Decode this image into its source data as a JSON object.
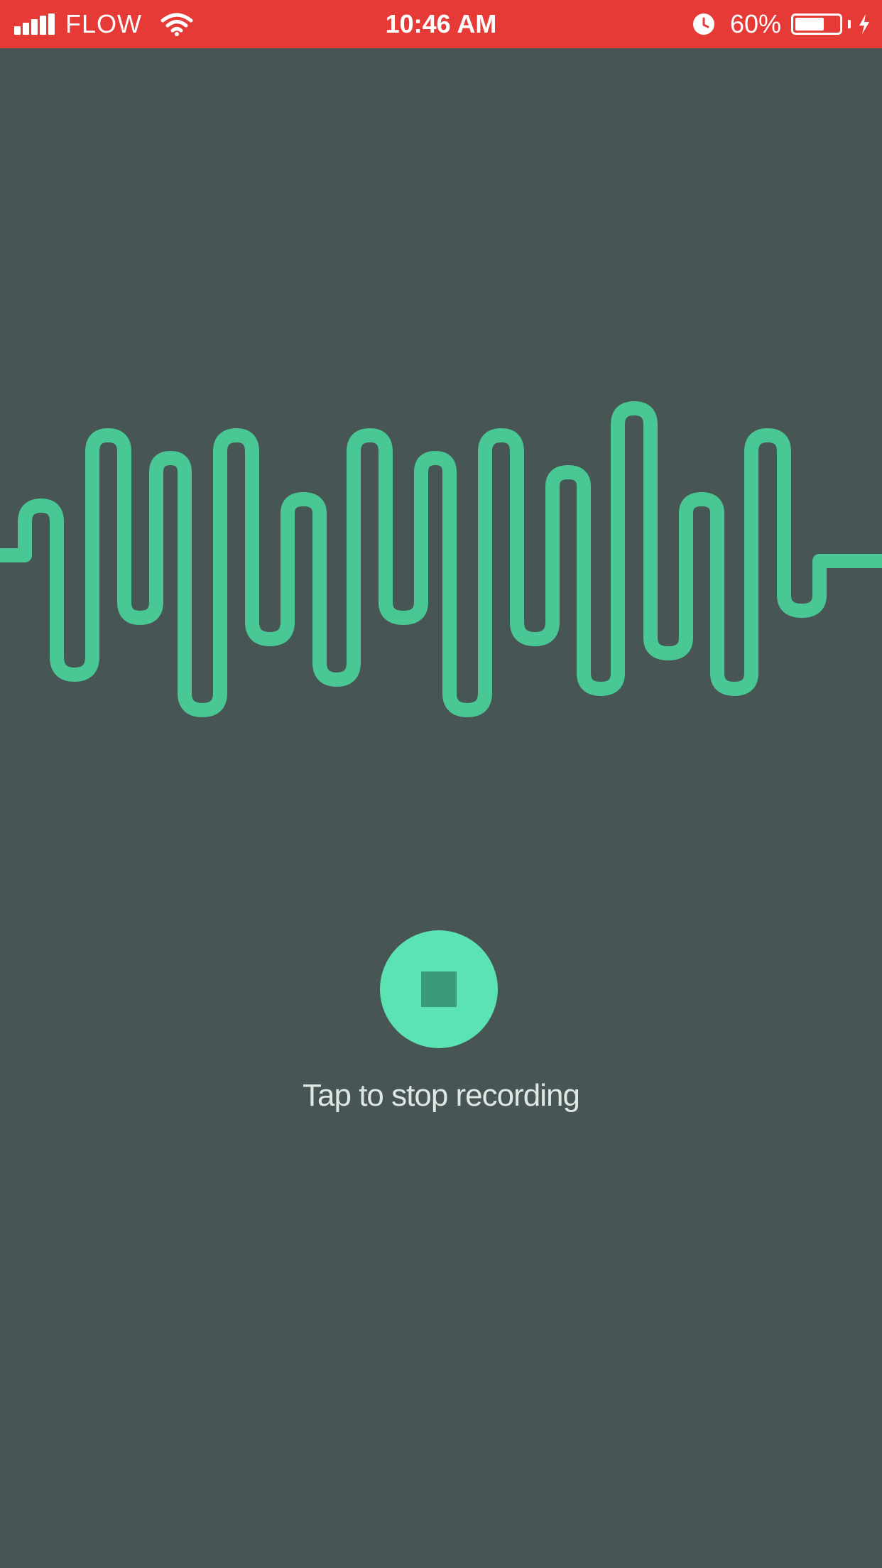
{
  "status_bar": {
    "carrier": "FLOW",
    "time": "10:46 AM",
    "battery_percent": "60%",
    "background_color": "#e53a36",
    "icons": [
      "signal-icon",
      "wifi-icon",
      "alarm-icon",
      "battery-icon",
      "charging-icon"
    ]
  },
  "recorder": {
    "waveform_color": "#49c794",
    "stop_button_color": "#5be3b3",
    "stop_icon": "stop-square-icon",
    "hint": "Tap to stop recording"
  },
  "theme": {
    "background": "#475554"
  }
}
